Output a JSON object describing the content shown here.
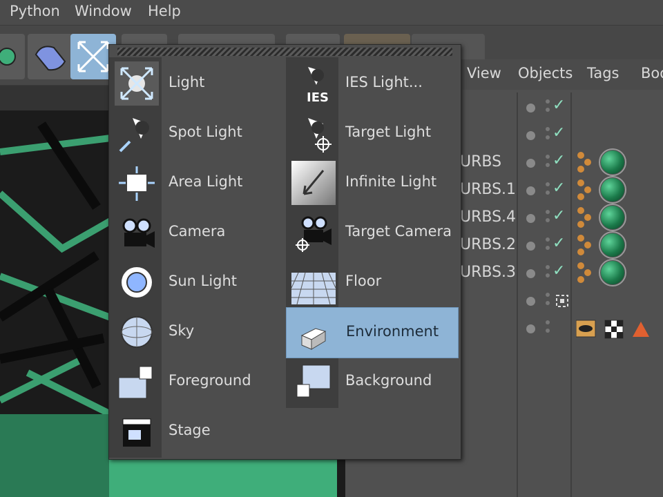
{
  "menubar": {
    "items": [
      "Python",
      "Window",
      "Help"
    ]
  },
  "object_manager": {
    "tabs": [
      "View",
      "Objects",
      "Tags",
      "Boo"
    ],
    "rows": [
      {
        "name": "",
        "check": true,
        "tag": false
      },
      {
        "name": "",
        "check": true,
        "tag": false
      },
      {
        "name": "URBS",
        "check": true,
        "tag": true
      },
      {
        "name": "URBS.1",
        "check": true,
        "tag": true
      },
      {
        "name": "URBS.4",
        "check": true,
        "tag": true
      },
      {
        "name": "URBS.2",
        "check": true,
        "tag": true
      },
      {
        "name": "URBS.3",
        "check": true,
        "tag": true
      },
      {
        "name": "",
        "check": false,
        "tag": false
      },
      {
        "name": "",
        "check": false,
        "tag": false
      }
    ]
  },
  "dropdown": {
    "left": [
      {
        "label": "Light",
        "icon": "light-icon"
      },
      {
        "label": "Spot Light",
        "icon": "spot-light-icon"
      },
      {
        "label": "Area Light",
        "icon": "area-light-icon"
      },
      {
        "label": "Camera",
        "icon": "camera-icon"
      },
      {
        "label": "Sun Light",
        "icon": "sun-light-icon"
      },
      {
        "label": "Sky",
        "icon": "sky-icon"
      },
      {
        "label": "Foreground",
        "icon": "foreground-icon"
      },
      {
        "label": "Stage",
        "icon": "stage-icon"
      }
    ],
    "right": [
      {
        "label": "IES Light...",
        "icon": "ies-light-icon"
      },
      {
        "label": "Target Light",
        "icon": "target-light-icon"
      },
      {
        "label": "Infinite Light",
        "icon": "infinite-light-icon"
      },
      {
        "label": "Target Camera",
        "icon": "target-camera-icon"
      },
      {
        "label": "Floor",
        "icon": "floor-icon"
      },
      {
        "label": "Environment",
        "icon": "environment-icon",
        "highlighted": true
      },
      {
        "label": "Background",
        "icon": "background-icon"
      }
    ],
    "ies_badge": "IES"
  },
  "colors": {
    "accent_highlight": "#8eb4d6",
    "ui_background": "#4d4d4d",
    "viewport_green": "#3fae7a",
    "check": "#8fe0c0"
  }
}
